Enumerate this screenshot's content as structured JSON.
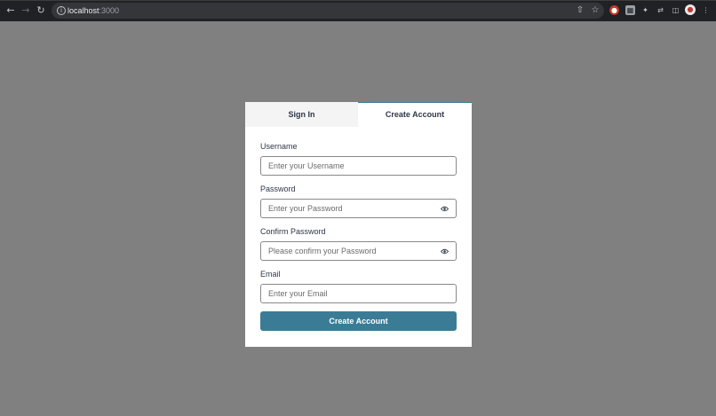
{
  "browser": {
    "url_host": "localhost",
    "url_port": ":3000",
    "icons": [
      "back-icon",
      "forward-icon",
      "reload-icon",
      "site-info-icon",
      "share-icon",
      "bookmark-star-icon",
      "extension-icon",
      "puzzle-icon",
      "sync-icon",
      "side-panel-icon",
      "profile-avatar-icon",
      "menu-icon"
    ]
  },
  "auth": {
    "tabs": {
      "signin": "Sign In",
      "create": "Create Account"
    },
    "fields": {
      "username": {
        "label": "Username",
        "placeholder": "Enter your Username"
      },
      "password": {
        "label": "Password",
        "placeholder": "Enter your Password"
      },
      "confirm": {
        "label": "Confirm Password",
        "placeholder": "Please confirm your Password"
      },
      "email": {
        "label": "Email",
        "placeholder": "Enter your Email"
      }
    },
    "submit_label": "Create Account"
  },
  "colors": {
    "accent": "#3a7c96",
    "backdrop": "#808080",
    "chrome": "#202124"
  }
}
